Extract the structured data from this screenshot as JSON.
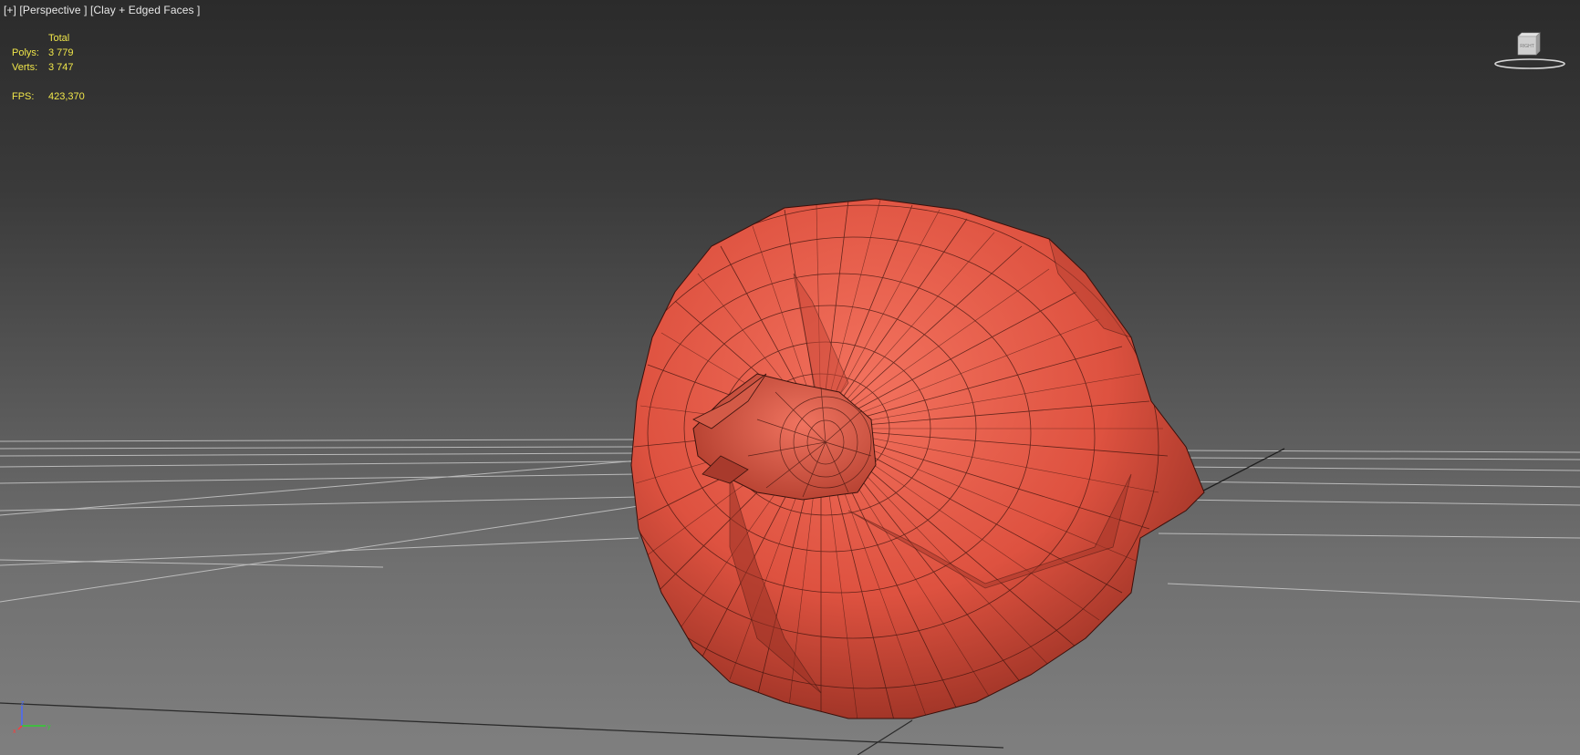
{
  "viewport": {
    "label": {
      "plus": "[+]",
      "view": "[Perspective ]",
      "shading": "[Clay + Edged Faces ]"
    },
    "stats": {
      "header": "Total",
      "polys_label": "Polys:",
      "polys_value": "3 779",
      "verts_label": "Verts:",
      "verts_value": "3 747",
      "fps_label": "FPS:",
      "fps_value": "423,370"
    },
    "viewcube": {
      "face_label": "RIGHT"
    },
    "axis": {
      "z": "z",
      "x": "x",
      "y": "y"
    }
  },
  "colors": {
    "stats_text": "#f0e64a",
    "model_clay": "#e8604e",
    "grid": "#c8c8c8",
    "background_top": "#2b2b2b",
    "background_bottom": "#7f7f7f"
  }
}
